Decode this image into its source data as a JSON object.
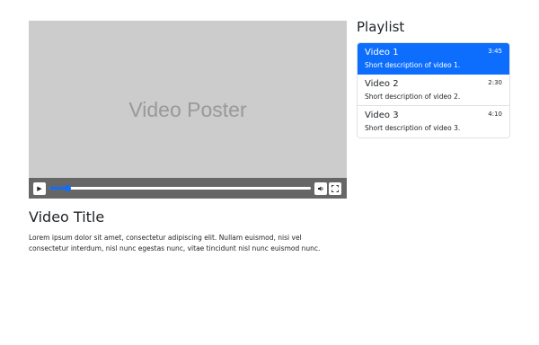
{
  "player": {
    "poster_text": "Video Poster",
    "progress": 0.07,
    "play_icon": "play-icon",
    "volume_icon": "volume-icon",
    "fullscreen_icon": "fullscreen-icon"
  },
  "video": {
    "title": "Video Title",
    "description": "Lorem ipsum dolor sit amet, consectetur adipiscing elit. Nullam euismod, nisi vel consectetur interdum, nisl nunc egestas nunc, vitae tincidunt nisl nunc euismod nunc."
  },
  "playlist": {
    "heading": "Playlist",
    "items": [
      {
        "title": "Video 1",
        "duration": "3:45",
        "description": "Short description of video 1.",
        "active": true
      },
      {
        "title": "Video 2",
        "duration": "2:30",
        "description": "Short description of video 2.",
        "active": false
      },
      {
        "title": "Video 3",
        "duration": "4:10",
        "description": "Short description of video 3.",
        "active": false
      }
    ]
  },
  "colors": {
    "accent": "#0d6efd",
    "poster_bg": "#cccccc",
    "controls_bg": "#666666"
  }
}
